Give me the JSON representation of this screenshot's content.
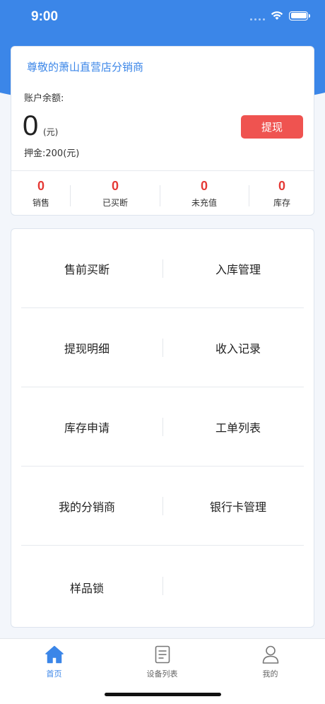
{
  "status_bar": {
    "time": "9:00"
  },
  "account": {
    "store_name": "尊敬的萧山直营店分销商",
    "balance_label": "账户余额:",
    "balance_value": "0",
    "balance_unit": "(元)",
    "deposit": "押金:200(元)",
    "withdraw_label": "提现"
  },
  "stats": [
    {
      "value": "0",
      "label": "销售"
    },
    {
      "value": "0",
      "label": "已买断"
    },
    {
      "value": "0",
      "label": "未充值"
    },
    {
      "value": "0",
      "label": "库存"
    }
  ],
  "menu": [
    [
      "售前买断",
      "入库管理"
    ],
    [
      "提现明细",
      "收入记录"
    ],
    [
      "库存申请",
      "工单列表"
    ],
    [
      "我的分销商",
      "银行卡管理"
    ],
    [
      "样品锁",
      ""
    ]
  ],
  "tabs": [
    {
      "label": "首页",
      "icon": "home-icon",
      "active": true
    },
    {
      "label": "设备列表",
      "icon": "document-list-icon",
      "active": false
    },
    {
      "label": "我的",
      "icon": "user-icon",
      "active": false
    }
  ],
  "colors": {
    "primary": "#3b86e8",
    "danger": "#ef5350",
    "stat_value": "#e53935"
  }
}
